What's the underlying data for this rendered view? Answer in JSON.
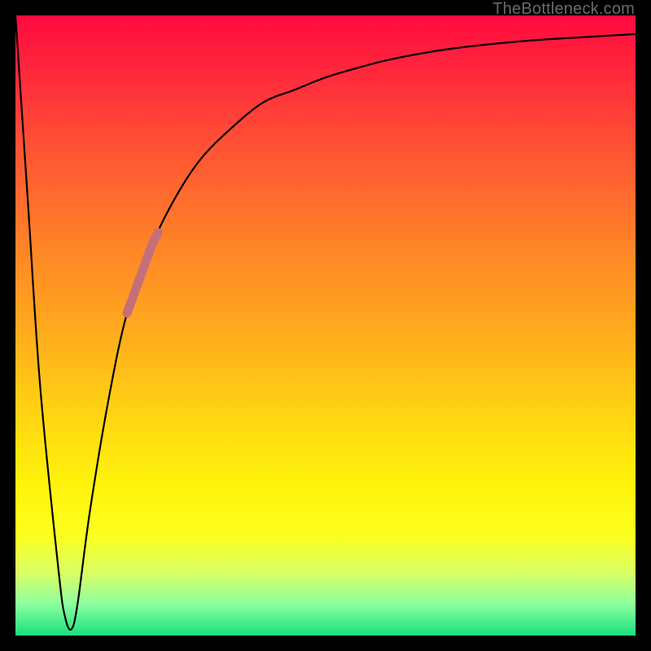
{
  "watermark": "TheBottleneck.com",
  "colors": {
    "curve": "#000000",
    "highlight": "#c47079",
    "frame": "#000000"
  },
  "chart_data": {
    "type": "line",
    "title": "",
    "xlabel": "",
    "ylabel": "",
    "xlim": [
      0,
      100
    ],
    "ylim": [
      0,
      100
    ],
    "grid": false,
    "series": [
      {
        "name": "bottleneck-curve",
        "x": [
          0,
          2,
          4,
          7,
          8,
          9,
          10,
          12,
          15,
          18,
          22,
          26,
          30,
          35,
          40,
          45,
          50,
          55,
          60,
          65,
          70,
          75,
          80,
          85,
          90,
          95,
          100
        ],
        "values": [
          100,
          70,
          40,
          10,
          3,
          1,
          5,
          20,
          38,
          52,
          63,
          71,
          77,
          82,
          86,
          88,
          90,
          91.5,
          92.8,
          93.8,
          94.6,
          95.2,
          95.7,
          96.1,
          96.4,
          96.7,
          97
        ]
      }
    ],
    "highlight_segment": {
      "series": "bottleneck-curve",
      "x_start": 18,
      "x_end": 23,
      "note": "thicker muted-pink band on the rising part of the curve"
    },
    "background_gradient": {
      "direction": "vertical",
      "stops": [
        {
          "pos": 0.0,
          "color": "#ff0a40"
        },
        {
          "pos": 0.5,
          "color": "#ffa81e"
        },
        {
          "pos": 0.8,
          "color": "#fff20a"
        },
        {
          "pos": 1.0,
          "color": "#18e07e"
        }
      ]
    }
  }
}
